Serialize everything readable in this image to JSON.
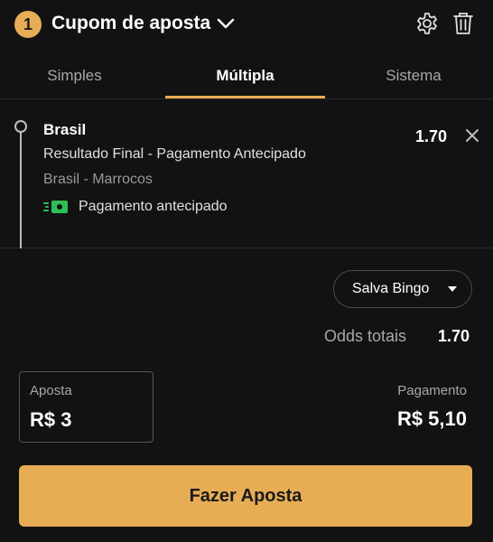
{
  "header": {
    "count": "1",
    "title": "Cupom de aposta",
    "icons": [
      "chevron-down-icon",
      "gear-icon",
      "trash-icon"
    ]
  },
  "tabs": [
    {
      "label": "Simples",
      "active": false
    },
    {
      "label": "Múltipla",
      "active": true
    },
    {
      "label": "Sistema",
      "active": false
    }
  ],
  "selection": {
    "team": "Brasil",
    "market": "Resultado Final - Pagamento Antecipado",
    "event": "Brasil - Marrocos",
    "early_payout_label": "Pagamento antecipado",
    "odds": "1.70"
  },
  "bonus": {
    "selected": "Salva Bingo"
  },
  "totals": {
    "odds_label": "Odds totais",
    "odds_value": "1.70"
  },
  "stake": {
    "label": "Aposta",
    "value": "R$ 3"
  },
  "payout": {
    "label": "Pagamento",
    "value": "R$ 5,10"
  },
  "place_bet_label": "Fazer Aposta",
  "colors": {
    "accent": "#e7ad55",
    "background": "#121212",
    "early_payout_icon": "#2fbf57"
  }
}
